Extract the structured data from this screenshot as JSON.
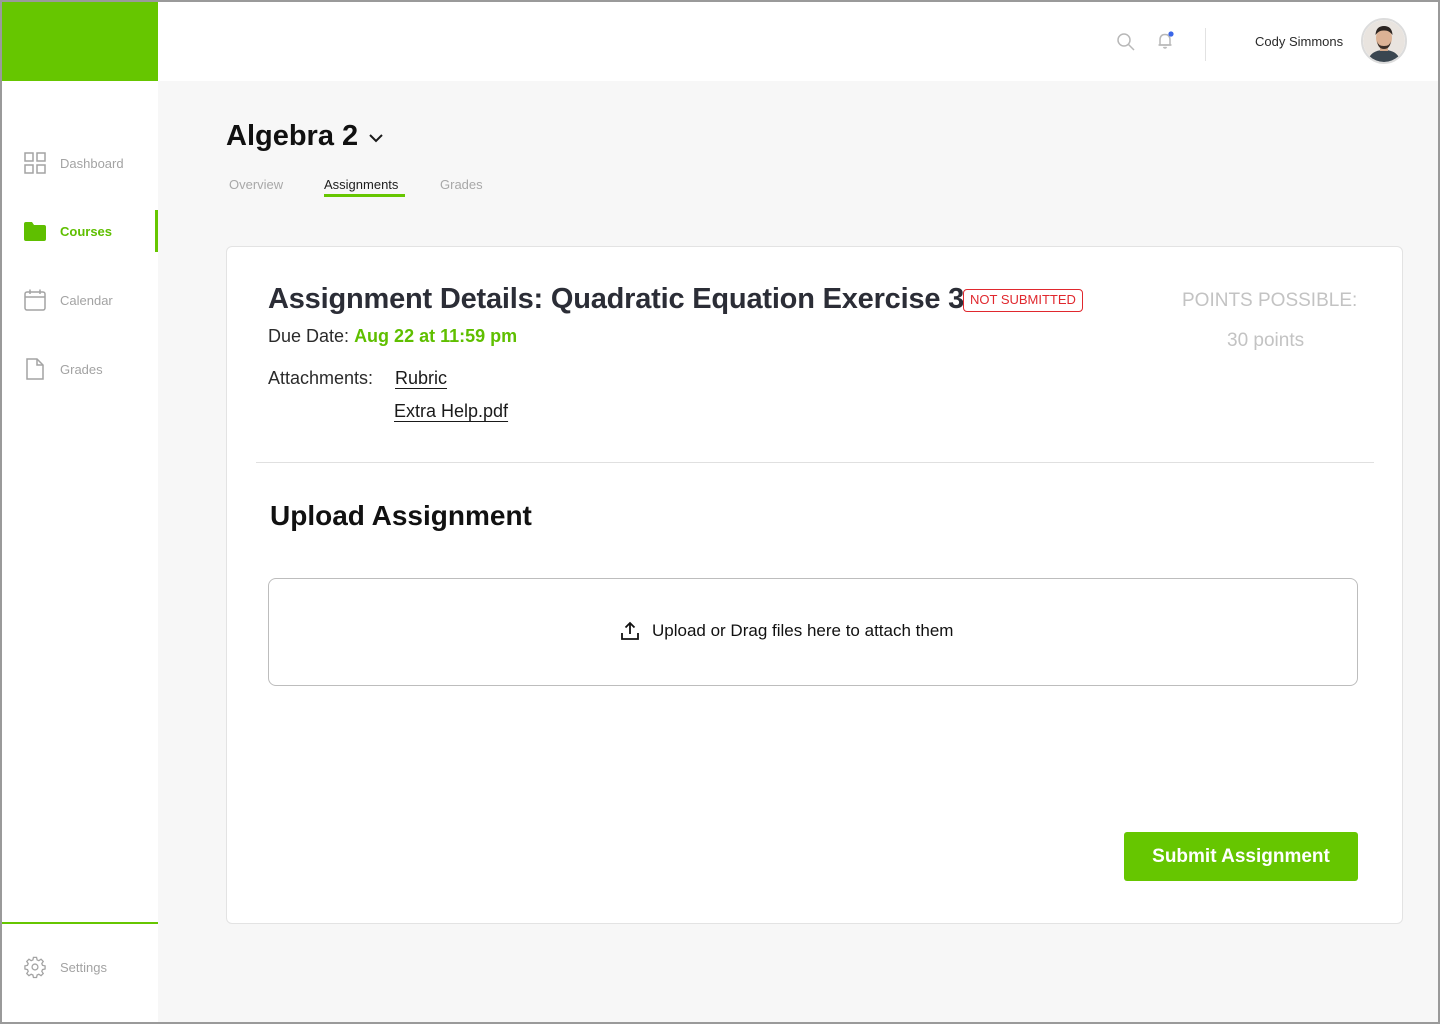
{
  "colors": {
    "brand_green": "#66c600",
    "status_red": "#e0282e",
    "muted_text": "#a3a3a3"
  },
  "sidebar": {
    "items": [
      {
        "label": "Dashboard",
        "icon": "grid-icon",
        "active": false
      },
      {
        "label": "Courses",
        "icon": "folder-icon",
        "active": true
      },
      {
        "label": "Calendar",
        "icon": "calendar-icon",
        "active": false
      },
      {
        "label": "Grades",
        "icon": "document-icon",
        "active": false
      }
    ],
    "settings": {
      "label": "Settings",
      "icon": "gear-icon"
    }
  },
  "header": {
    "icons": [
      "search-icon",
      "bell-icon"
    ],
    "notification_dot": true,
    "user_name": "Cody Simmons",
    "avatar_icon": "avatar-photo"
  },
  "course": {
    "title": "Algebra 2",
    "tabs": [
      {
        "label": "Overview",
        "active": false
      },
      {
        "label": "Assignments",
        "active": true
      },
      {
        "label": "Grades",
        "active": false
      }
    ]
  },
  "assignment": {
    "title": "Assignment Details: Quadratic Equation Exercise 3",
    "status": "NOT SUBMITTED",
    "due_label": "Due Date:",
    "due_value": "Aug 22 at 11:59 pm",
    "attachments_label": "Attachments:",
    "attachments": [
      "Rubric",
      "Extra Help.pdf"
    ],
    "points_label": "POINTS POSSIBLE:",
    "points_value": "30 points"
  },
  "upload": {
    "title": "Upload Assignment",
    "dropzone_text": "Upload or Drag files here to attach them",
    "dropzone_icon": "upload-icon",
    "submit_label": "Submit Assignment"
  }
}
